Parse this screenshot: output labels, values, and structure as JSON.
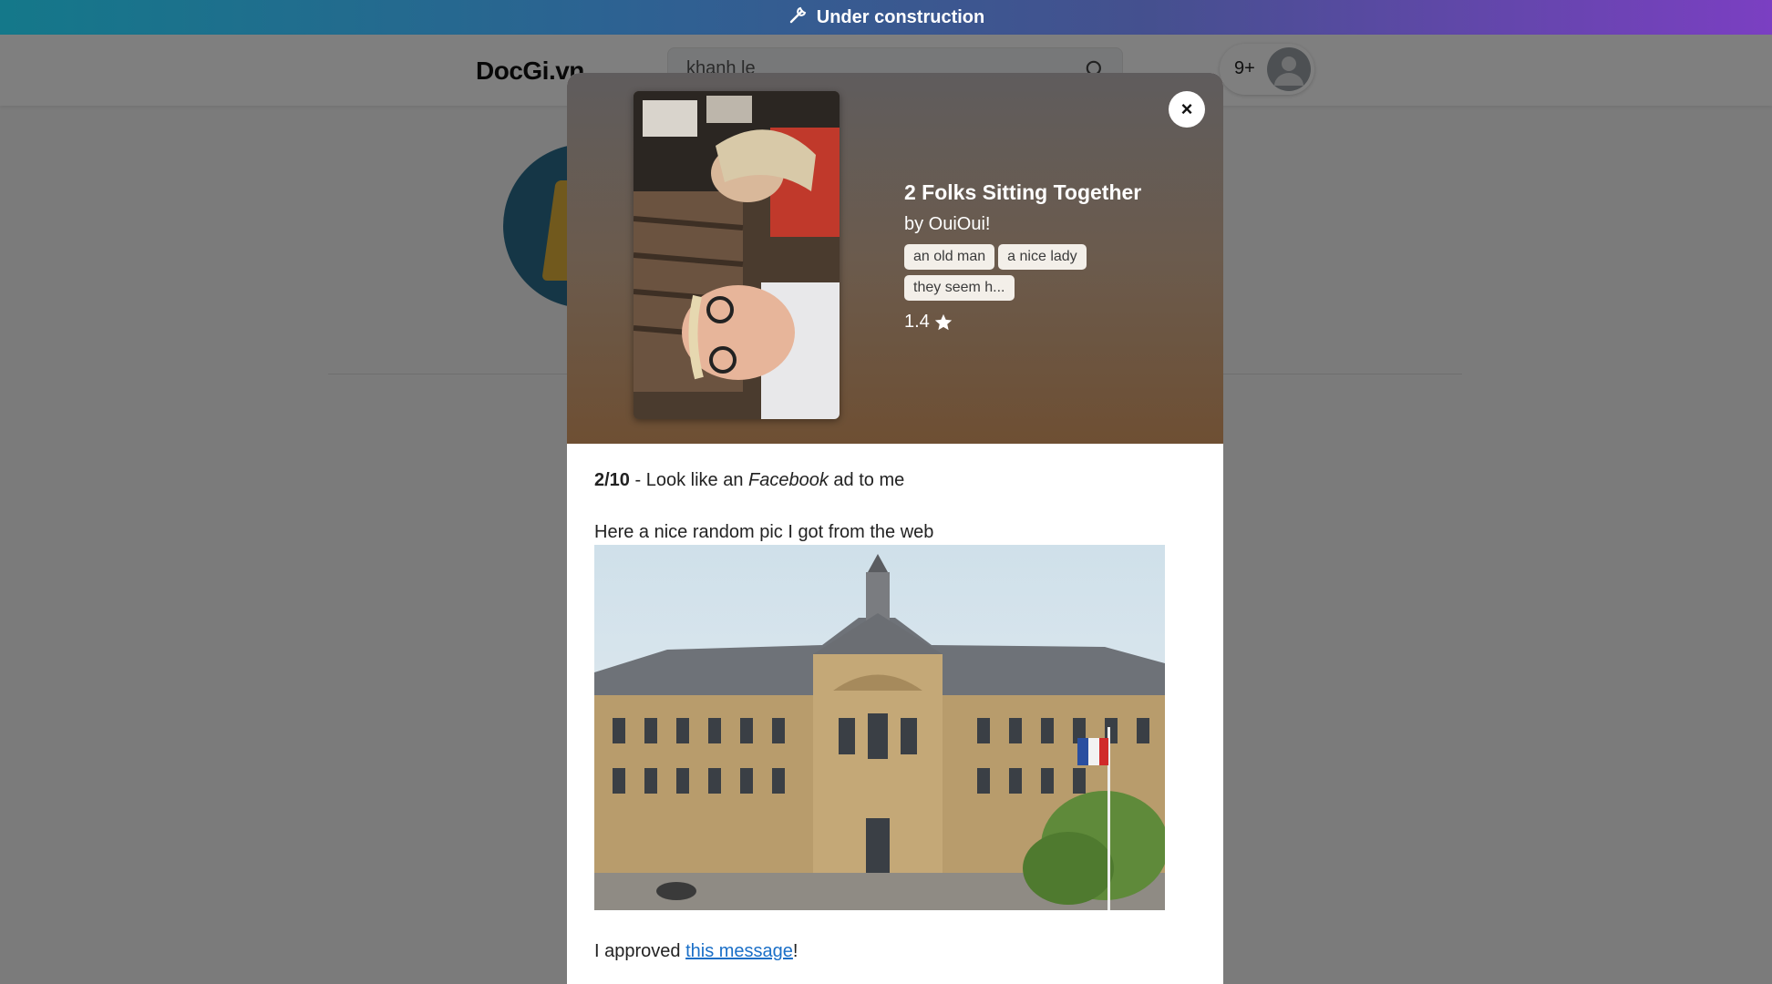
{
  "banner": {
    "text": "Under construction",
    "icon": "wrench-icon"
  },
  "navbar": {
    "logo": "DocGi.vn",
    "search_value": "khanh le",
    "notification_count": "9+"
  },
  "modal": {
    "title": "2 Folks Sitting Together",
    "author": "by OuiOui!",
    "tags": [
      "an old man",
      "a nice lady",
      "they seem h..."
    ],
    "rating": "1.4",
    "close_label": "×",
    "review": {
      "score": "2/10",
      "text_before": " - Look like an ",
      "emphasis": "Facebook",
      "text_after": " ad to me"
    },
    "caption": "Here a nice random pic I got from the web",
    "approval": {
      "prefix": "I approved ",
      "link": "this message",
      "suffix": "!"
    }
  },
  "colors": {
    "banner_start": "#14788a",
    "banner_end": "#7b3fc2",
    "header_brown": "#6e4f33",
    "link": "#1a6fc7"
  }
}
